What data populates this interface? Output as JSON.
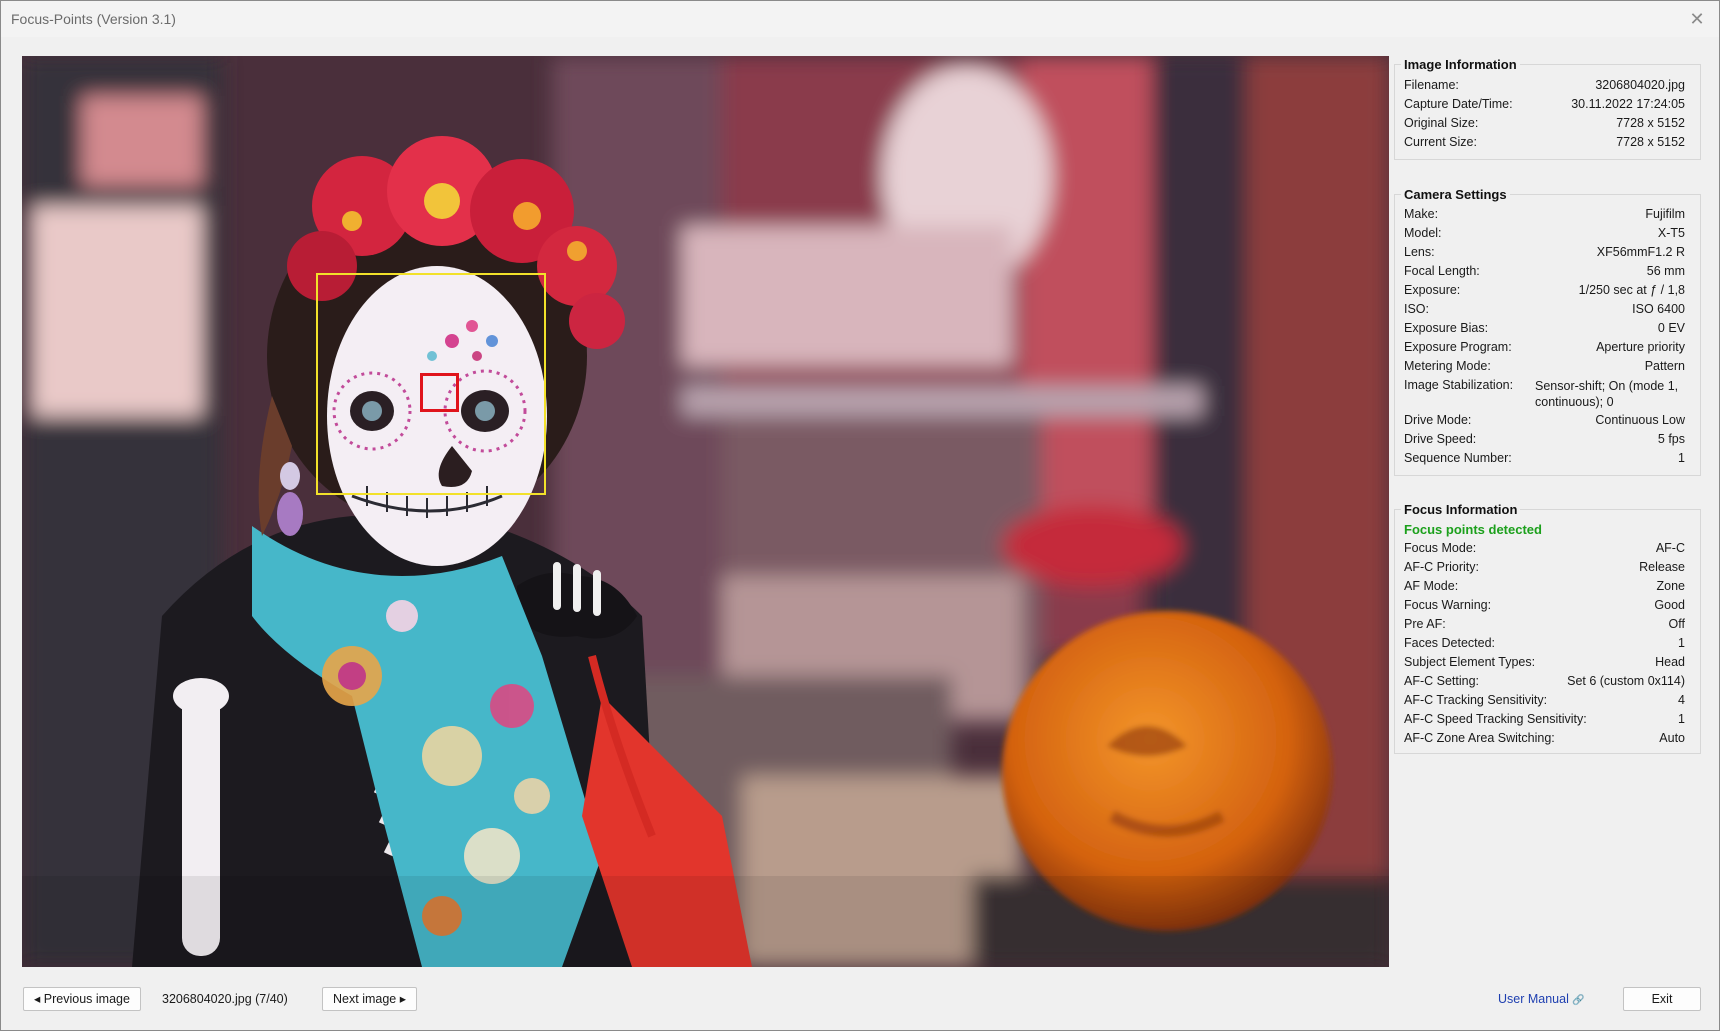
{
  "window": {
    "title": "Focus-Points (Version 3.1)",
    "close_glyph": "✕"
  },
  "image_info": {
    "heading": "Image Information",
    "rows": [
      {
        "key": "Filename:",
        "value": "3206804020.jpg"
      },
      {
        "key": "Capture Date/Time:",
        "value": "30.11.2022 17:24:05"
      },
      {
        "key": "Original Size:",
        "value": "7728 x 5152"
      },
      {
        "key": "Current Size:",
        "value": "7728 x 5152"
      }
    ]
  },
  "camera_settings": {
    "heading": "Camera Settings",
    "rows": [
      {
        "key": "Make:",
        "value": "Fujifilm"
      },
      {
        "key": "Model:",
        "value": "X-T5"
      },
      {
        "key": "Lens:",
        "value": "XF56mmF1.2 R"
      },
      {
        "key": "Focal Length:",
        "value": "56 mm"
      },
      {
        "key": "Exposure:",
        "value": "1/250 sec at ƒ / 1,8"
      },
      {
        "key": "ISO:",
        "value": "ISO 6400"
      },
      {
        "key": "Exposure Bias:",
        "value": "0 EV"
      },
      {
        "key": "Exposure Program:",
        "value": "Aperture priority"
      },
      {
        "key": "Metering Mode:",
        "value": "Pattern"
      },
      {
        "key": "Image Stabilization:",
        "value": "Sensor-shift; On (mode 1, continuous); 0"
      },
      {
        "key": "Drive Mode:",
        "value": "Continuous Low"
      },
      {
        "key": "Drive Speed:",
        "value": "5 fps"
      },
      {
        "key": "Sequence Number:",
        "value": "1"
      }
    ]
  },
  "focus_info": {
    "heading": "Focus Information",
    "status": "Focus points detected",
    "status_color": "#1ca01c",
    "rows": [
      {
        "key": "Focus Mode:",
        "value": "AF-C"
      },
      {
        "key": "AF-C Priority:",
        "value": "Release"
      },
      {
        "key": "AF Mode:",
        "value": "Zone"
      },
      {
        "key": "Focus Warning:",
        "value": "Good"
      },
      {
        "key": "Pre AF:",
        "value": "Off"
      },
      {
        "key": "Faces Detected:",
        "value": "1"
      },
      {
        "key": "Subject Element Types:",
        "value": "Head"
      },
      {
        "key": "AF-C Setting:",
        "value": "Set 6 (custom 0x114)"
      },
      {
        "key": "AF-C Tracking Sensitivity:",
        "value": "4"
      },
      {
        "key": "AF-C Speed Tracking Sensitivity:",
        "value": "1"
      },
      {
        "key": "AF-C Zone Area Switching:",
        "value": "Auto"
      }
    ]
  },
  "overlay": {
    "face_frame_color": "#f2e12a",
    "focus_point_color": "#e0141c"
  },
  "footer": {
    "prev_label": "◂ Previous image",
    "file_index": "3206804020.jpg (7/40)",
    "next_label": "Next image ▸",
    "manual_label": "User Manual",
    "manual_icon": "🔗",
    "exit_label": "Exit"
  }
}
